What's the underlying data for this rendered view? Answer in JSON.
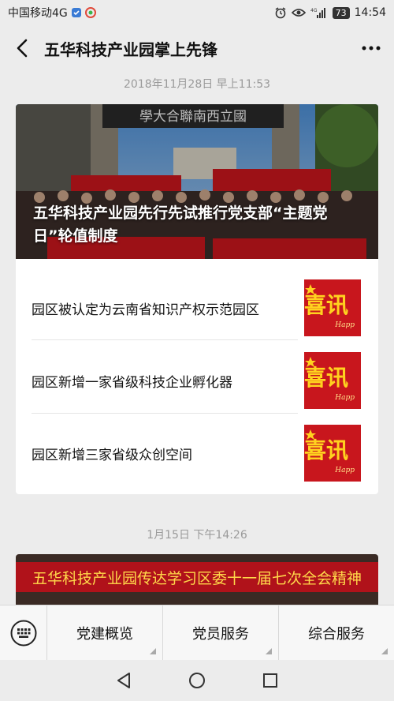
{
  "status_bar": {
    "carrier": "中国移动4G",
    "network": "4G",
    "battery": "73",
    "time": "14:54"
  },
  "header": {
    "title": "五华科技产业园掌上先锋"
  },
  "feed": {
    "timestamp_1": "2018年11月28日 早上11:53",
    "hero": {
      "banner_sign": "學大合聯南西立國",
      "title": "五华科技产业园先行先试推行党支部“主题党日”轮值制度"
    },
    "articles": [
      {
        "title": "园区被认定为云南省知识产权示范园区",
        "thumb_text": "喜讯",
        "thumb_sub": "Happ"
      },
      {
        "title": "园区新增一家省级科技企业孵化器",
        "thumb_text": "喜讯",
        "thumb_sub": "Happ"
      },
      {
        "title": "园区新增三家省级众创空间",
        "thumb_text": "喜讯",
        "thumb_sub": "Happ"
      }
    ],
    "timestamp_2": "1月15日 下午14:26",
    "card2_banner": "五华科技产业园传达学习区委十一届七次全会精神"
  },
  "menu": {
    "items": [
      "党建概览",
      "党员服务",
      "综合服务"
    ]
  },
  "colors": {
    "background": "#ececec",
    "card": "#ffffff",
    "banner_red": "#c8161d",
    "text_gray": "#9a9a9a"
  }
}
